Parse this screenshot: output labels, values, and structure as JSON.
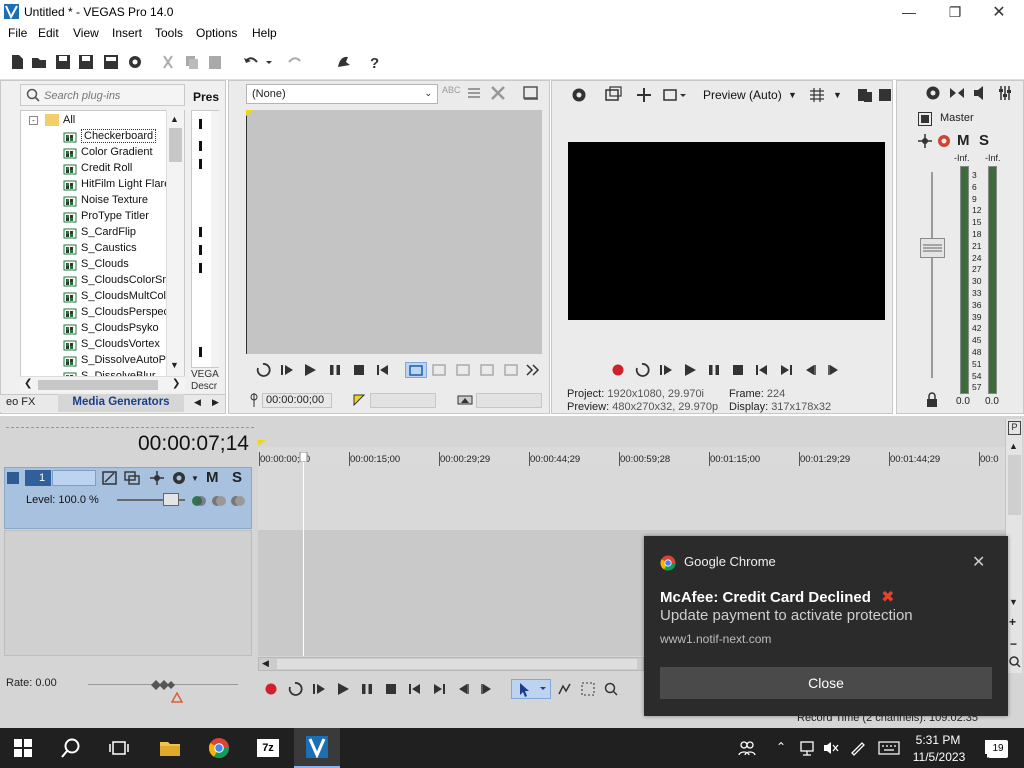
{
  "window": {
    "title": "Untitled * - VEGAS Pro 14.0"
  },
  "menu": [
    "File",
    "Edit",
    "View",
    "Insert",
    "Tools",
    "Options",
    "Help"
  ],
  "plugins": {
    "search_placeholder": "Search plug-ins",
    "presets_label": "Pres",
    "tree_root": "All",
    "items": [
      "Checkerboard",
      "Color Gradient",
      "Credit Roll",
      "HitFilm Light Flares",
      "Noise Texture",
      "ProType Titler",
      "S_CardFlip",
      "S_Caustics",
      "S_Clouds",
      "S_CloudsColorSmooth",
      "S_CloudsMultColor",
      "S_CloudsPerspective",
      "S_CloudsPsyko",
      "S_CloudsVortex",
      "S_DissolveAutoPaint",
      "S_DissolveBlur"
    ],
    "selected": "Checkerboard",
    "desc_line1": "VEGA",
    "desc_line2": "Descr",
    "tab_video_fx": "eo FX",
    "tab_media_generators": "Media Generators"
  },
  "trimmer": {
    "dropdown_value": "(None)",
    "timecode": "00:00:00;00"
  },
  "preview": {
    "quality": "Preview (Auto)",
    "project_label": "Project:",
    "project_value": "1920x1080, 29.970i",
    "preview_label": "Preview:",
    "preview_value": "480x270x32, 29.970p",
    "frame_label": "Frame:",
    "frame_value": "224",
    "display_label": "Display:",
    "display_value": "317x178x32"
  },
  "master": {
    "label": "Master",
    "m_label": "M",
    "s_label": "S",
    "inf_left": "-Inf.",
    "inf_right": "-Inf.",
    "scale": [
      "3",
      "6",
      "9",
      "12",
      "15",
      "18",
      "21",
      "24",
      "27",
      "30",
      "33",
      "36",
      "39",
      "42",
      "45",
      "48",
      "51",
      "54",
      "57"
    ],
    "db_left": "0.0",
    "db_right": "0.0"
  },
  "timeline": {
    "time_counter": "00:00:07;14",
    "track_number": "1",
    "track_m": "M",
    "track_s": "S",
    "level": "Level: 100.0 %",
    "rate": "Rate: 0.00",
    "ruler": [
      "00:00:00;00",
      "00:00:15;00",
      "00:00:29;29",
      "00:00:44;29",
      "00:00:59;28",
      "00:01:15;00",
      "00:01:29;29",
      "00:01:44;29",
      "00:0"
    ],
    "record_time": "Record Time (2 channels): 109:02:35"
  },
  "notification": {
    "app": "Google Chrome",
    "title": "McAfee: Credit Card Declined",
    "body": "Update payment to activate protection",
    "url": "www1.notif-next.com",
    "close_button": "Close"
  },
  "taskbar": {
    "time": "5:31 PM",
    "date": "11/5/2023",
    "notification_count": "19"
  }
}
